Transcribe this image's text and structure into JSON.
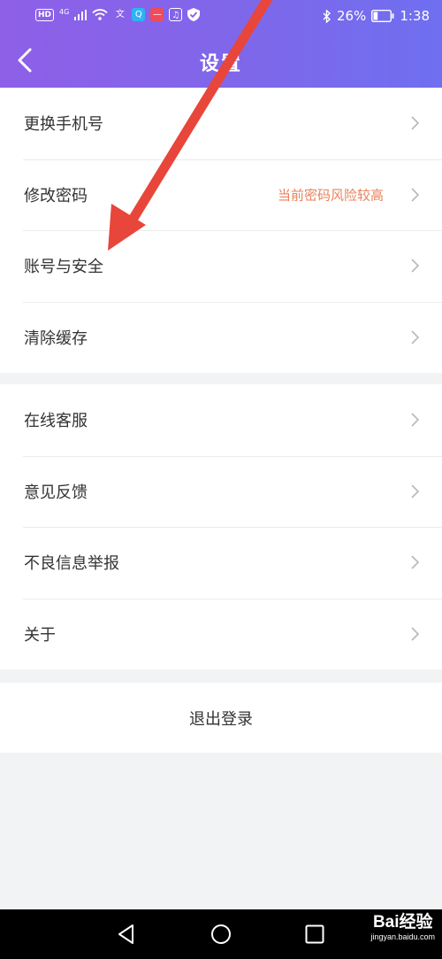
{
  "status_bar": {
    "hd_badge": "HD",
    "network": "4G",
    "battery_percent": "26%",
    "time": "1:38",
    "battery_level": 0.26
  },
  "header": {
    "title": "设置"
  },
  "groups": [
    {
      "items": [
        {
          "label": "更换手机号",
          "note": ""
        },
        {
          "label": "修改密码",
          "note": "当前密码风险较高"
        },
        {
          "label": "账号与安全",
          "note": ""
        },
        {
          "label": "清除缓存",
          "note": ""
        }
      ]
    },
    {
      "items": [
        {
          "label": "在线客服",
          "note": ""
        },
        {
          "label": "意见反馈",
          "note": ""
        },
        {
          "label": "不良信息举报",
          "note": ""
        },
        {
          "label": "关于",
          "note": ""
        }
      ]
    }
  ],
  "logout": {
    "label": "退出登录"
  },
  "watermark": {
    "brand": "Bai经验",
    "url": "jingyan.baidu.com"
  },
  "colors": {
    "header_start": "#8e5fe8",
    "header_end": "#6f6ff0",
    "note": "#e8825a",
    "annotation_arrow": "#e8463a"
  }
}
